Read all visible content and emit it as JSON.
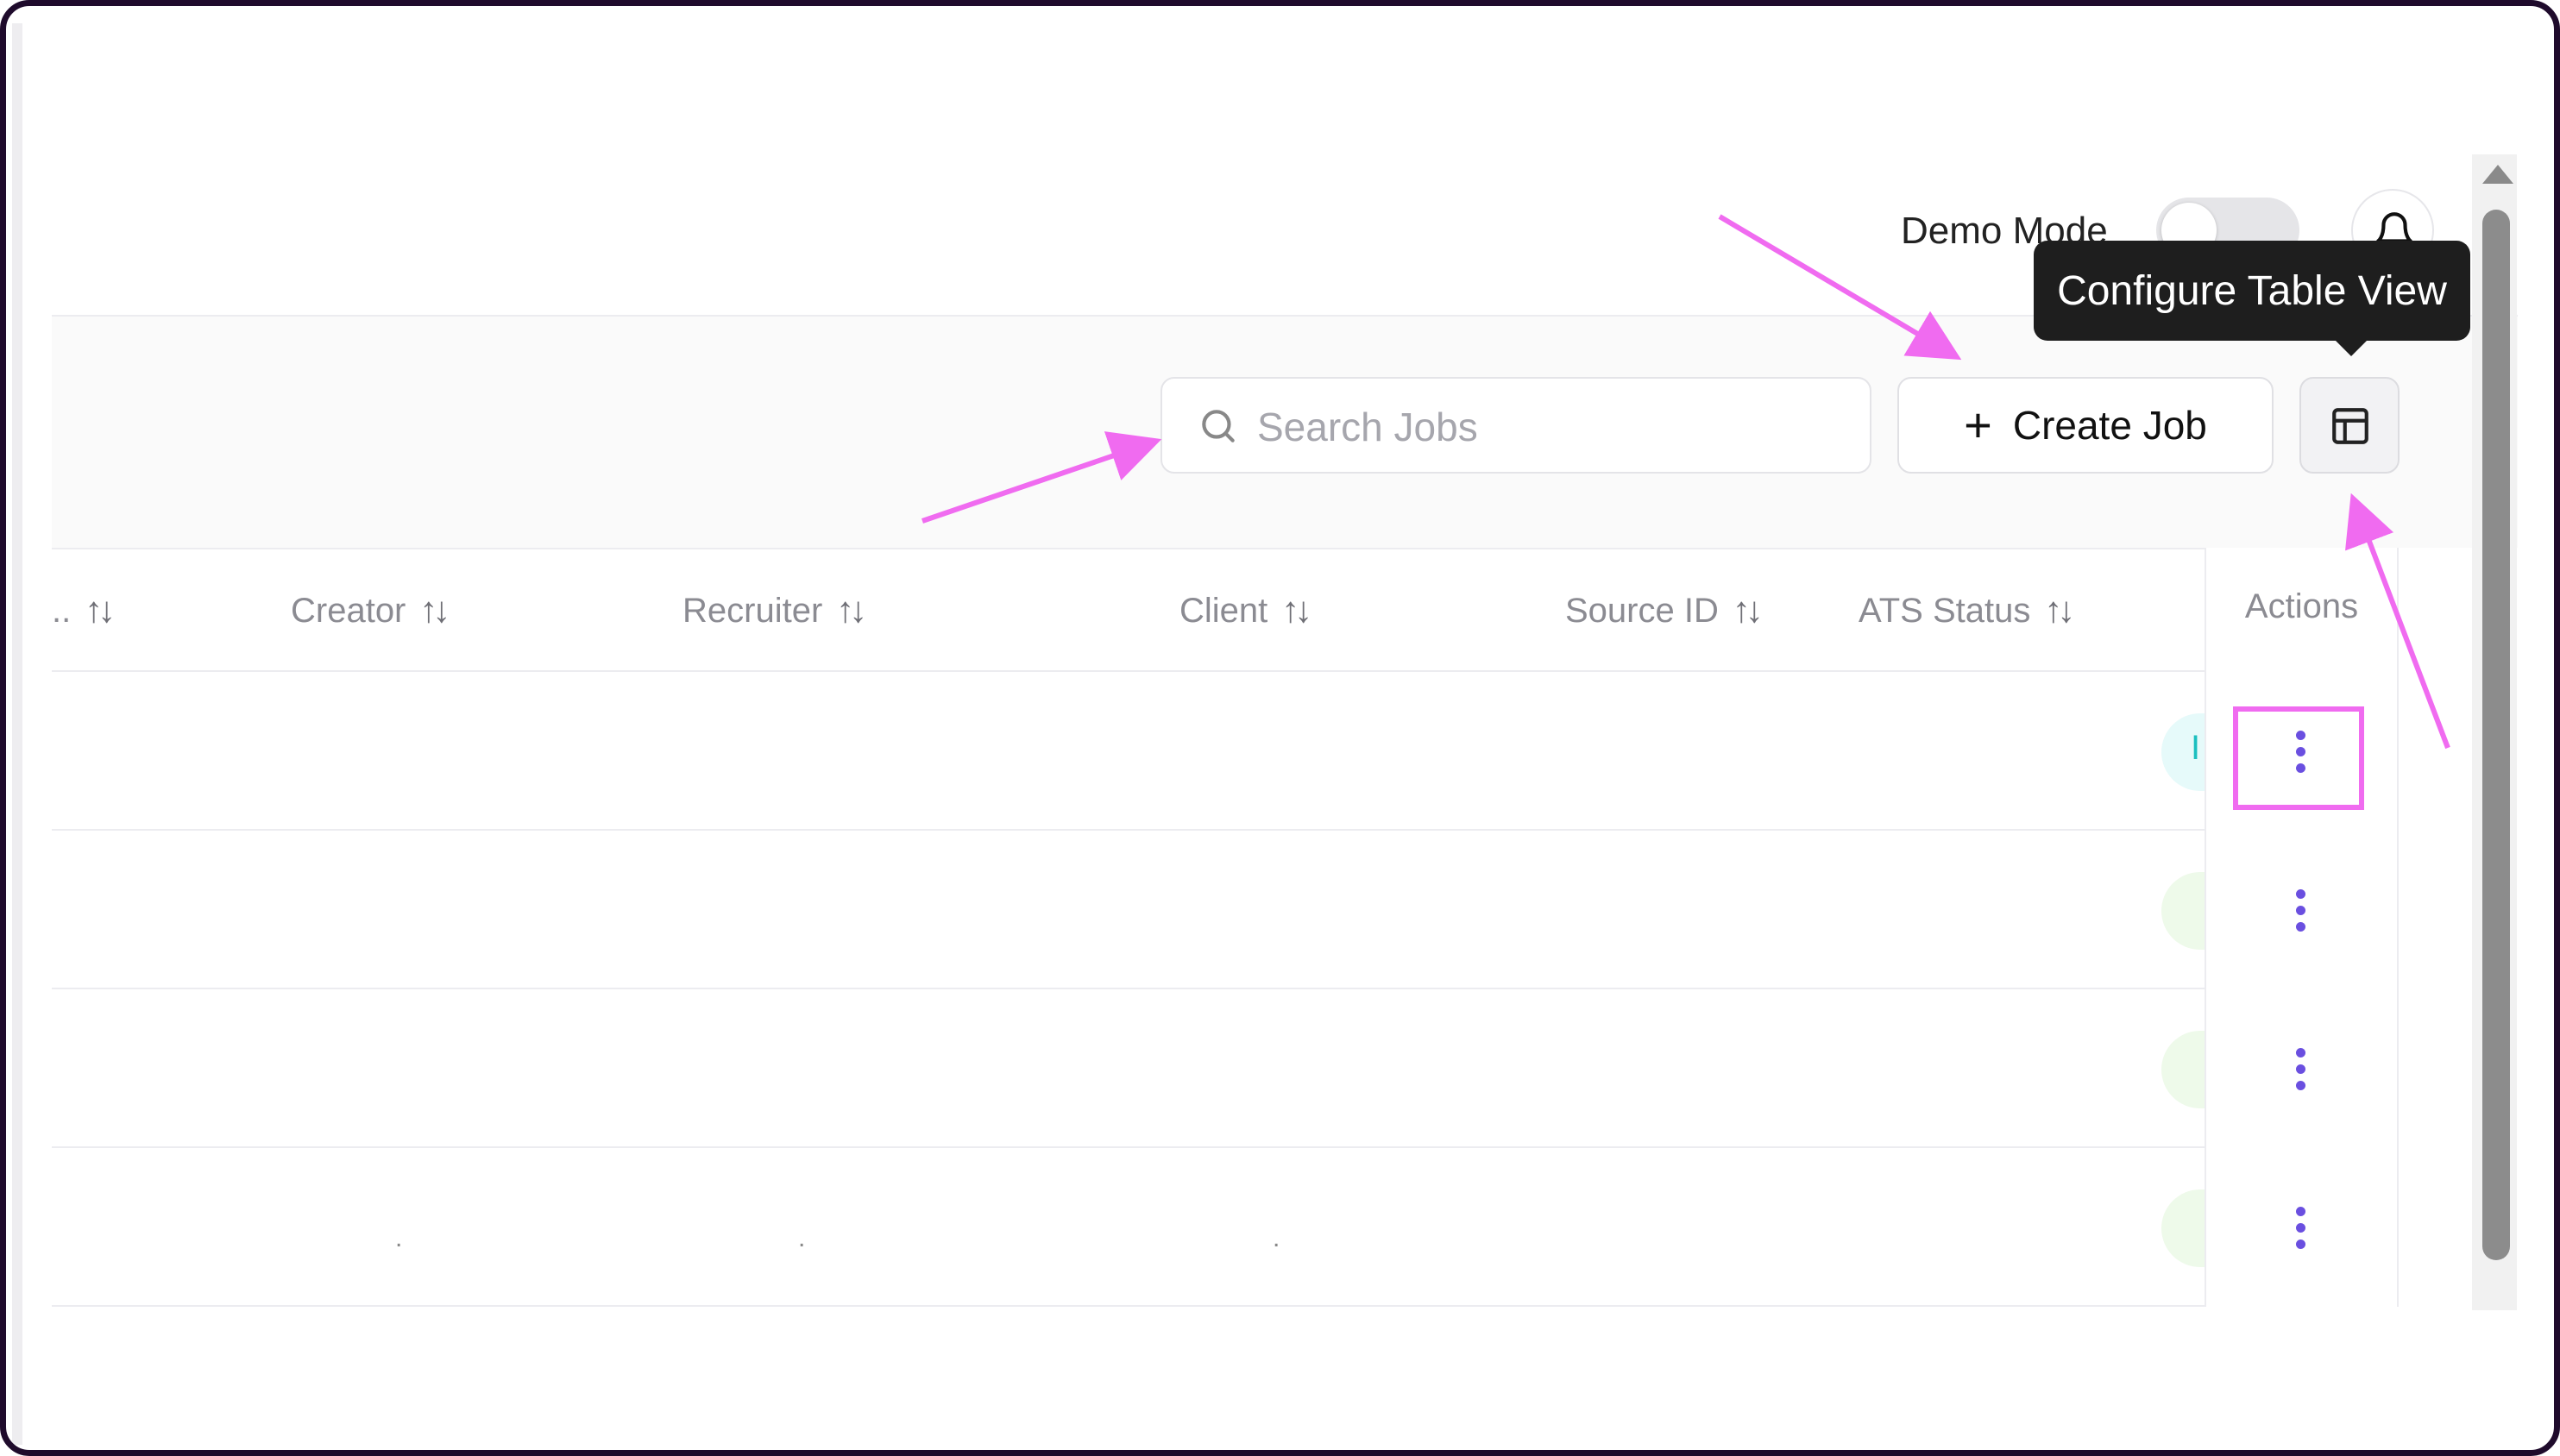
{
  "header": {
    "demo_mode_label": "Demo Mode",
    "demo_mode_on": false,
    "notification_icon": "bell-icon"
  },
  "toolbar": {
    "search_placeholder": "Search Jobs",
    "search_icon": "search-icon",
    "create_job_label": "Create Job",
    "create_job_icon": "plus-icon",
    "config_icon": "table-layout-icon",
    "config_tooltip": "Configure Table View"
  },
  "table": {
    "columns": [
      {
        "label": "..",
        "sortable": true
      },
      {
        "label": "Creator",
        "sortable": true
      },
      {
        "label": "Recruiter",
        "sortable": true
      },
      {
        "label": "Client",
        "sortable": true
      },
      {
        "label": "Source ID",
        "sortable": true
      },
      {
        "label": "ATS Status",
        "sortable": true
      },
      {
        "label": "Actions",
        "sortable": false
      }
    ],
    "sort_glyph": "↑↓",
    "rows": [
      {
        "status_letter": "I",
        "status_color": "#e6fafa"
      },
      {
        "status_letter": "",
        "status_color": "#eefaea"
      },
      {
        "status_letter": "",
        "status_color": "#eefaea"
      },
      {
        "status_letter": "",
        "status_color": "#eefaea",
        "cell_marks": [
          ".",
          ".",
          "."
        ]
      }
    ]
  },
  "colors": {
    "annotation_pink": "#f06bf0",
    "kebab_purple": "#6a4fe0",
    "tooltip_bg": "#1e1e1e"
  }
}
